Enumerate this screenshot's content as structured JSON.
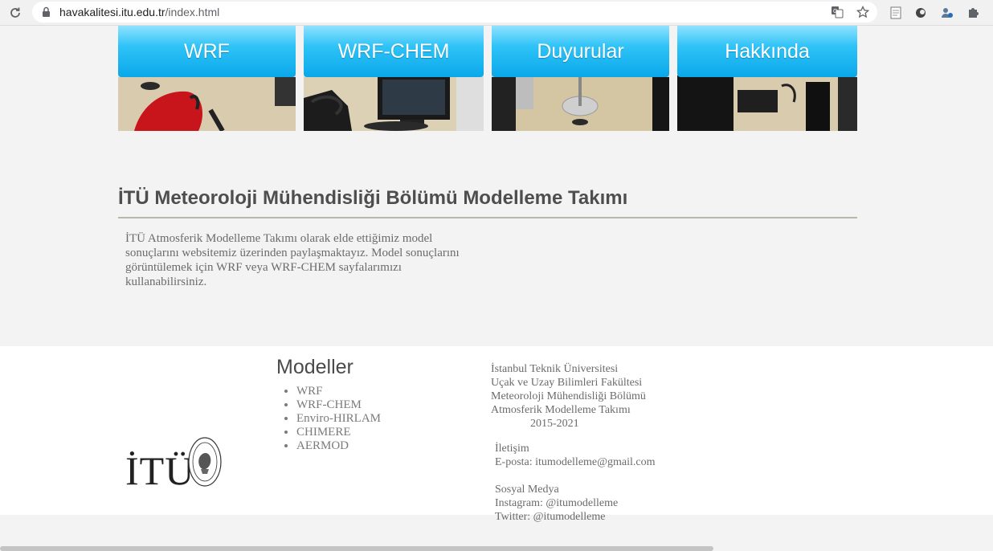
{
  "browser": {
    "url_host": "havakalitesi.itu.edu.tr",
    "url_path": "/index.html",
    "icons": [
      "reload-icon",
      "lock-icon",
      "translate-icon",
      "bookmark-star-icon",
      "extension-page-icon",
      "extension-circle-icon",
      "extension-person-icon",
      "puzzle-icon"
    ]
  },
  "tiles": [
    {
      "label": "WRF"
    },
    {
      "label": "WRF-CHEM"
    },
    {
      "label": "Duyurular"
    },
    {
      "label": "Hakkında"
    }
  ],
  "main": {
    "heading": "İTÜ Meteoroloji Mühendisliği Bölümü Modelleme Takımı",
    "intro_lines": [
      "İTÜ Atmosferik Modelleme Takımı olarak elde ettiğimiz model",
      "sonuçlarını websitemiz üzerinden paylaşmaktayız. Model sonuçlarını",
      "görüntülemek için WRF veya WRF-CHEM sayfalarımızı",
      "kullanabilirsiniz."
    ]
  },
  "footer": {
    "logo_text": "İTÜ",
    "models_title": "Modeller",
    "models": [
      "WRF",
      "WRF-CHEM",
      "Enviro-HIRLAM",
      "CHIMERE",
      "AERMOD"
    ],
    "institution_lines": [
      "İstanbul Teknik Üniversitesi",
      "Uçak ve Uzay Bilimleri Fakültesi",
      "Meteoroloji Mühendisliği Bölümü",
      "Atmosferik Modelleme Takımı"
    ],
    "years": "2015-2021",
    "contact_title": "İletişim",
    "email_line": "E-posta:  itumodelleme@gmail.com",
    "social_title": "Sosyal Medya",
    "instagram_line": "Instagram: @itumodelleme",
    "twitter_line": "Twitter: @itumodelleme"
  },
  "colors": {
    "tile_gradient_top": "#8fe2ff",
    "tile_gradient_bottom": "#0aa8ea",
    "page_background": "#f3f3f3",
    "rule": "#b9b6ab"
  }
}
